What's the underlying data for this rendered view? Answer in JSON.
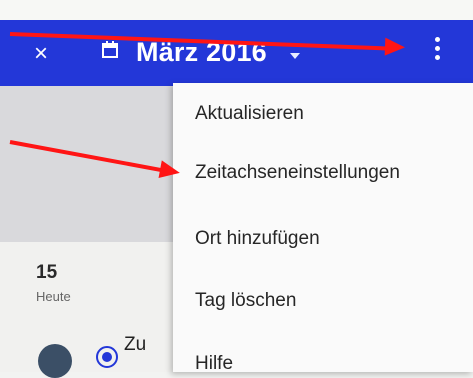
{
  "header": {
    "close_icon": "×",
    "calendar_icon": "calendar-icon",
    "month_title": "März 2016",
    "caret_icon": "chevron-down-icon",
    "more_icon": "more-vert-icon"
  },
  "menu": {
    "items": [
      {
        "label": "Aktualisieren"
      },
      {
        "label": "Zeitachseneinstellungen"
      },
      {
        "label": "Ort hinzufügen"
      },
      {
        "label": "Tag löschen"
      },
      {
        "label": "Hilfe"
      }
    ]
  },
  "day_panel": {
    "day_number": "15",
    "day_label": "Heute",
    "entry_text": "Zu"
  },
  "colors": {
    "accent": "#2337d8",
    "annotation_arrow": "#ff1515"
  }
}
